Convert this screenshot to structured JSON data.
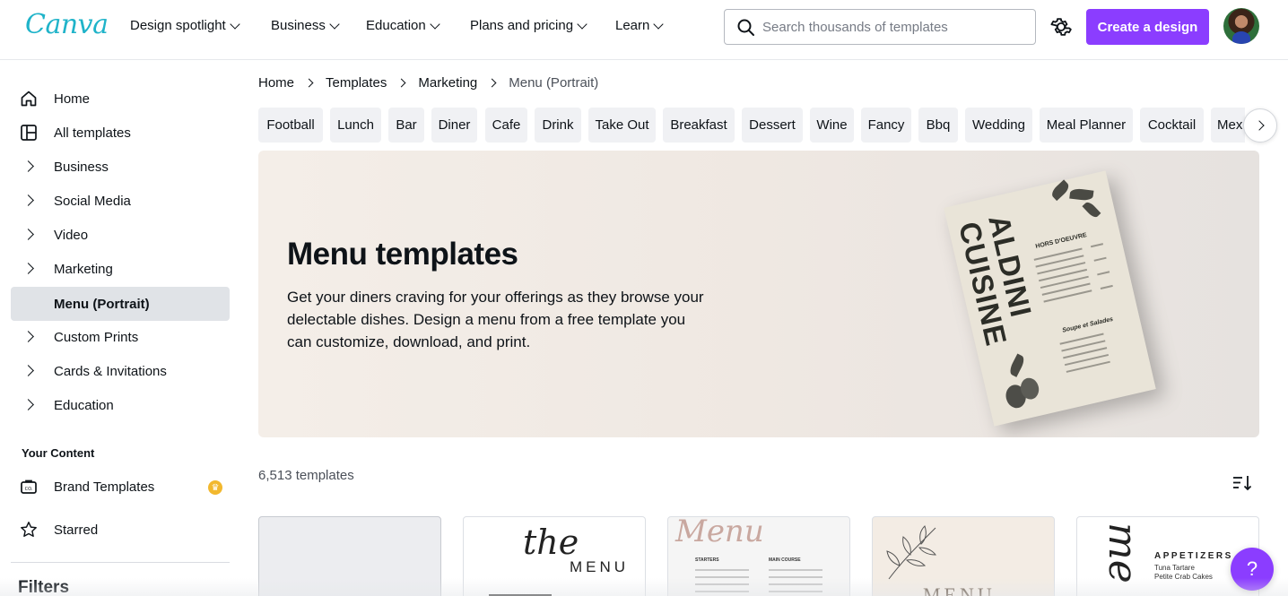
{
  "header": {
    "logo": "Canva",
    "nav": [
      {
        "label": "Design spotlight"
      },
      {
        "label": "Business"
      },
      {
        "label": "Education"
      },
      {
        "label": "Plans and pricing"
      },
      {
        "label": "Learn"
      }
    ],
    "search_placeholder": "Search thousands of templates",
    "create_button": "Create a design"
  },
  "sidebar": {
    "items": [
      {
        "label": "Home",
        "icon": "home-icon"
      },
      {
        "label": "All templates",
        "icon": "templates-icon"
      },
      {
        "label": "Business"
      },
      {
        "label": "Social Media"
      },
      {
        "label": "Video"
      },
      {
        "label": "Marketing"
      },
      {
        "label": "Menu (Portrait)",
        "active": true
      },
      {
        "label": "Custom Prints"
      },
      {
        "label": "Cards & Invitations"
      },
      {
        "label": "Education"
      }
    ],
    "your_content": "Your Content",
    "brand_templates": "Brand Templates",
    "starred": "Starred",
    "filters": "Filters"
  },
  "breadcrumb": [
    "Home",
    "Templates",
    "Marketing",
    "Menu (Portrait)"
  ],
  "chips": [
    "Football",
    "Lunch",
    "Bar",
    "Diner",
    "Cafe",
    "Drink",
    "Take Out",
    "Breakfast",
    "Dessert",
    "Wine",
    "Fancy",
    "Bbq",
    "Wedding",
    "Meal Planner",
    "Cocktail",
    "Mex"
  ],
  "hero": {
    "title": "Menu templates",
    "description": "Get your diners craving for your offerings as they browse your delectable dishes. Design a menu from a free template you can customize, download, and print.",
    "card_title": "ALDINI CUISINE",
    "card_section_1": "HORS D'OEUVRE",
    "card_section_2": "Soupe et Salades"
  },
  "results": {
    "count": "6,513 templates"
  },
  "thumbnails": {
    "t2_script": "the",
    "t2_caps": "MENU",
    "t3_script": "Menu",
    "t3_col1": "STARTERS",
    "t3_col2": "MAIN COURSE",
    "t4_caps": "MENU",
    "t5_title": "APPETIZERS",
    "t5_line1": "Tuna Tartare",
    "t5_line2": "Petite Crab Cakes"
  },
  "help_label": "?",
  "colors": {
    "accent": "#8b3dff",
    "logo": "#1fb3c9",
    "active_bg": "#e0e3e7"
  }
}
